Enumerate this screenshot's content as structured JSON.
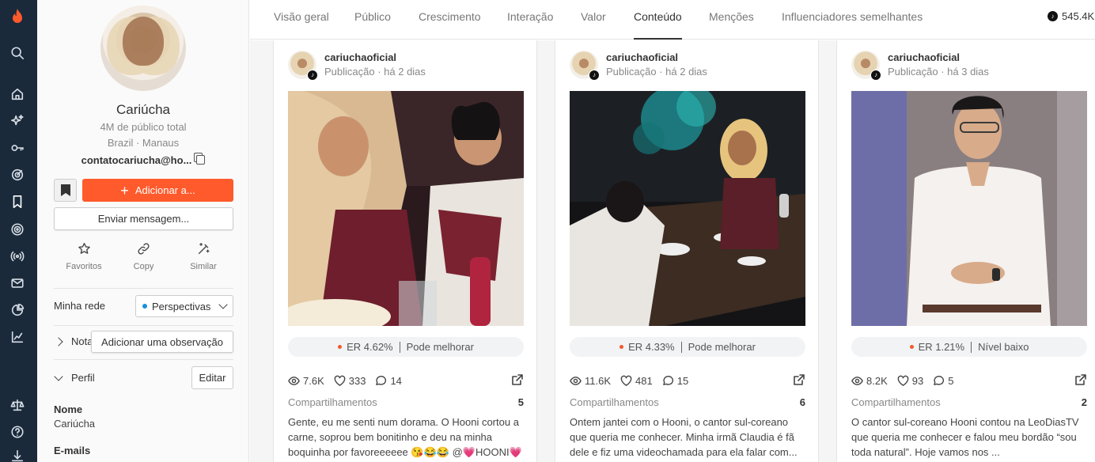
{
  "nav_tabs": [
    "Visão geral",
    "Público",
    "Crescimento",
    "Interação",
    "Valor",
    "Conteúdo",
    "Menções",
    "Influenciadores semelhantes"
  ],
  "active_tab": "Conteúdo",
  "followers": "545.4K",
  "profile": {
    "name": "Cariúcha",
    "audience": "4M de público total",
    "location": "Brazil · Manaus",
    "email": "contatocariucha@ho...",
    "add_button": "Adicionar a...",
    "message_button": "Enviar mensagem...",
    "actions": [
      "Favoritos",
      "Copy",
      "Similar"
    ],
    "network_label": "Minha rede",
    "network_value": "Perspectivas",
    "notes_label": "Nota",
    "notes_tooltip": "Adicionar uma observação",
    "profile_label": "Perfil",
    "edit_button": "Editar",
    "name_field_label": "Nome",
    "name_field_value": "Cariúcha",
    "emails_label": "E-mails"
  },
  "posts": [
    {
      "user": "cariuchaoficial",
      "time": "Publicação · há 2 dias",
      "er": "ER 4.62%",
      "quality": "Pode melhorar",
      "views": "7.6K",
      "likes": "333",
      "comments": "14",
      "shares_label": "Compartilhamentos",
      "shares": "5",
      "caption": "Gente, eu me senti num dorama. O Hooni cortou a carne, soprou bem bonitinho e deu na minha boquinha por favoreeeeee 😘😂😂 @💗HOONI💗"
    },
    {
      "user": "cariuchaoficial",
      "time": "Publicação · há 2 dias",
      "er": "ER 4.33%",
      "quality": "Pode melhorar",
      "views": "11.6K",
      "likes": "481",
      "comments": "15",
      "shares_label": "Compartilhamentos",
      "shares": "6",
      "caption": "Ontem jantei com o Hooni, o cantor sul-coreano que queria me conhecer. Minha irmã Claudia é fã dele e fiz uma videochamada para ela falar com..."
    },
    {
      "user": "cariuchaoficial",
      "time": "Publicação · há 3 dias",
      "er": "ER 1.21%",
      "quality": "Nível baixo",
      "views": "8.2K",
      "likes": "93",
      "comments": "5",
      "shares_label": "Compartilhamentos",
      "shares": "2",
      "caption": "O cantor sul-coreano Hooni contou na LeoDiasTV que queria me conhecer e falou meu bordão “sou toda natural”. Hoje vamos nos ..."
    }
  ],
  "colors": {
    "accent": "#ff5a2c",
    "rail": "#1a2a3a",
    "er_dot": "#f05a2c",
    "network_dot": "#1a8fdc"
  }
}
